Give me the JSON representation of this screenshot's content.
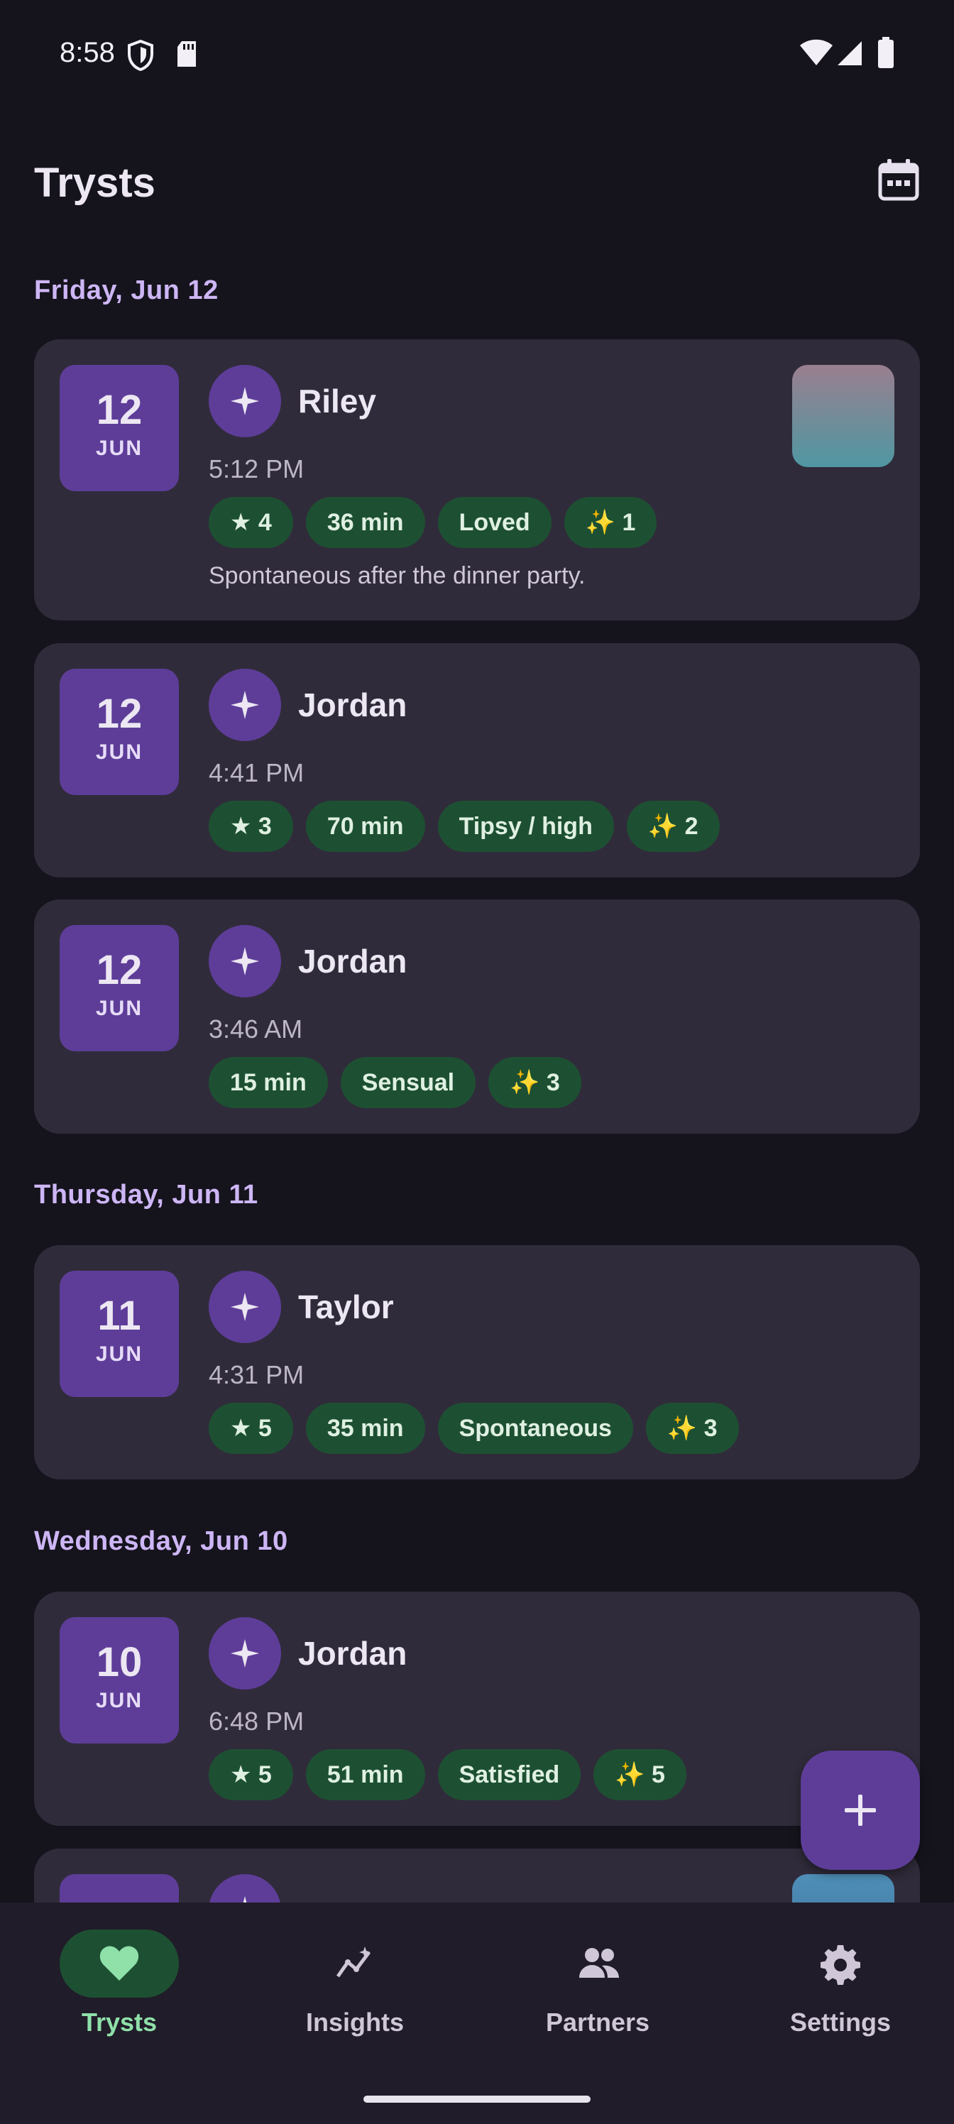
{
  "status_bar": {
    "time": "8:58"
  },
  "app": {
    "title": "Trysts"
  },
  "sections": [
    {
      "label": "Friday, Jun 12",
      "entries": [
        {
          "day": "12",
          "month": "JUN",
          "partner": "Riley",
          "time": "5:12 PM",
          "chips": [
            "★ 4",
            "36 min",
            "Loved",
            "✨ 1"
          ],
          "note": "Spontaneous after the dinner party."
        },
        {
          "day": "12",
          "month": "JUN",
          "partner": "Jordan",
          "time": "4:41 PM",
          "chips": [
            "★ 3",
            "70 min",
            "Tipsy / high",
            "✨ 2"
          ]
        },
        {
          "day": "12",
          "month": "JUN",
          "partner": "Jordan",
          "time": "3:46 AM",
          "chips": [
            "15 min",
            "Sensual",
            "✨ 3"
          ]
        }
      ]
    },
    {
      "label": "Thursday, Jun 11",
      "entries": [
        {
          "day": "11",
          "month": "JUN",
          "partner": "Taylor",
          "time": "4:31 PM",
          "chips": [
            "★ 5",
            "35 min",
            "Spontaneous",
            "✨ 3"
          ]
        }
      ]
    },
    {
      "label": "Wednesday, Jun 10",
      "entries": [
        {
          "day": "10",
          "month": "JUN",
          "partner": "Jordan",
          "time": "6:48 PM",
          "chips": [
            "★ 5",
            "51 min",
            "Satisfied",
            "✨ 5"
          ]
        }
      ]
    }
  ],
  "nav": {
    "items": [
      {
        "label": "Trysts",
        "icon": "heart-icon",
        "active": true
      },
      {
        "label": "Insights",
        "icon": "insights-icon"
      },
      {
        "label": "Partners",
        "icon": "people-icon"
      },
      {
        "label": "Settings",
        "icon": "gear-icon"
      }
    ]
  },
  "colors": {
    "background": "#15131c",
    "card": "#302b3a",
    "accent": "#5e3d99",
    "chip": "#1d5032",
    "section": "#cdb6f5"
  }
}
